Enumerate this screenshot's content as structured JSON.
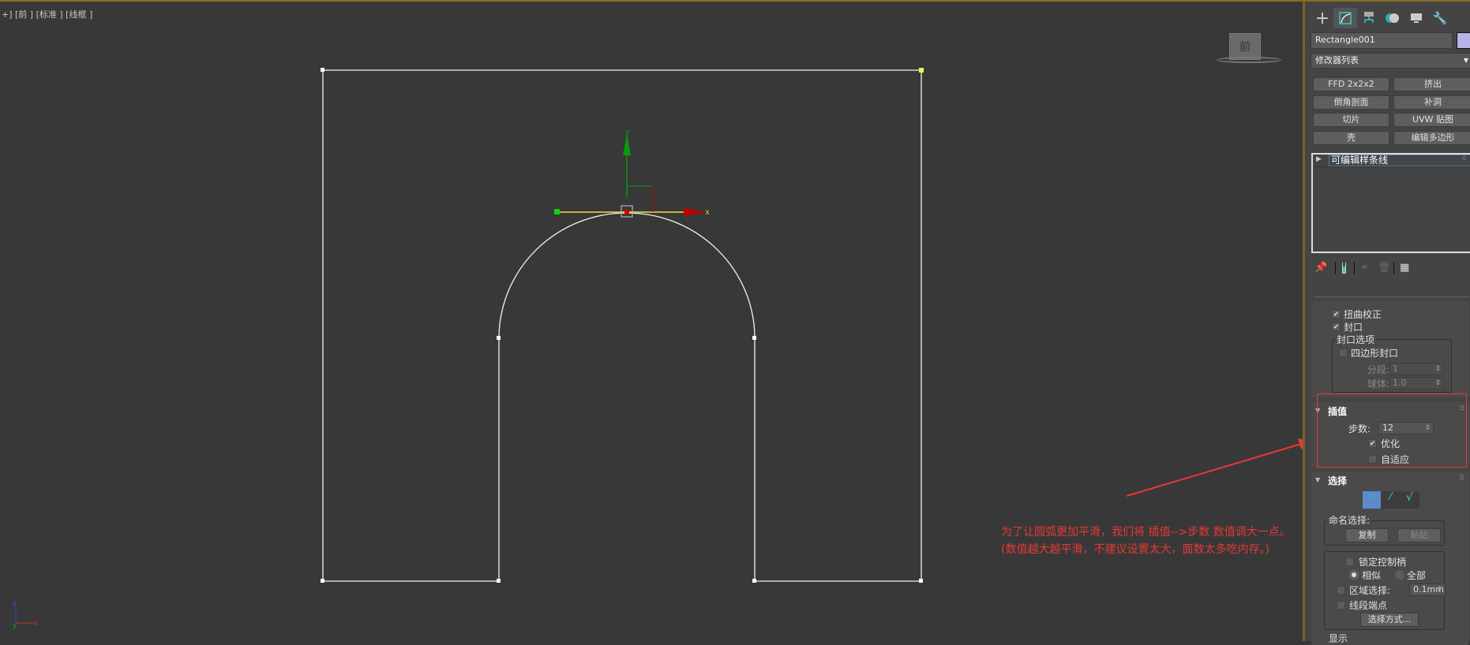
{
  "viewport": {
    "label": "+] [前 ] [标准 ] [线框 ]",
    "viewcube_label": "前",
    "gizmo": {
      "x_label": "x",
      "y_label": "y"
    },
    "axis_tripod": {
      "x_label": "x",
      "y_label": "y"
    }
  },
  "annotation": {
    "line1": "为了让圆弧更加平滑，我们将 插值-->步数 数值调大一点。",
    "line2": "(数值越大越平滑，不建议设置太大，面数太多吃内存。)",
    "color": "#e53935"
  },
  "panel": {
    "tabs": [
      "create-icon",
      "modify-icon",
      "hierarchy-icon",
      "motion-icon",
      "display-icon",
      "utilities-icon"
    ],
    "object_name": "Rectangle001",
    "object_color": "#b4b4e8",
    "modifier_list": "修改器列表",
    "modifier_buttons": [
      "FFD 2x2x2",
      "挤出",
      "倒角剖面",
      "补洞",
      "切片",
      "UVW 贴图",
      "壳",
      "编辑多边形"
    ],
    "stack": [
      {
        "label": "可编辑样条线"
      }
    ],
    "rendering": {
      "torque_fix": {
        "label": "扭曲校正",
        "checked": true
      },
      "cap": {
        "label": "封口",
        "checked": true
      },
      "cap_options_label": "封口选项",
      "quad_cap": {
        "label": "四边形封口",
        "checked": false
      },
      "segments_label": "分段:",
      "segments_value": "1",
      "sphere_label": "球体:",
      "sphere_value": "1.0"
    },
    "interpolation": {
      "title": "插值",
      "steps_label": "步数:",
      "steps_value": "12",
      "optimize": {
        "label": "优化",
        "checked": true
      },
      "adaptive": {
        "label": "自适应",
        "checked": false
      }
    },
    "selection": {
      "title": "选择",
      "named_selection_label": "命名选择:",
      "copy_label": "复制",
      "paste_label": "粘贴",
      "lock_handles": {
        "label": "锁定控制柄",
        "checked": false
      },
      "alike_label": "相似",
      "all_label": "全部",
      "area_selection": {
        "label": "区域选择:",
        "checked": false,
        "value": "0.1mm"
      },
      "segment_end": {
        "label": "线段端点",
        "checked": false
      },
      "select_by_label": "选择方式...",
      "display_label": "显示"
    }
  }
}
